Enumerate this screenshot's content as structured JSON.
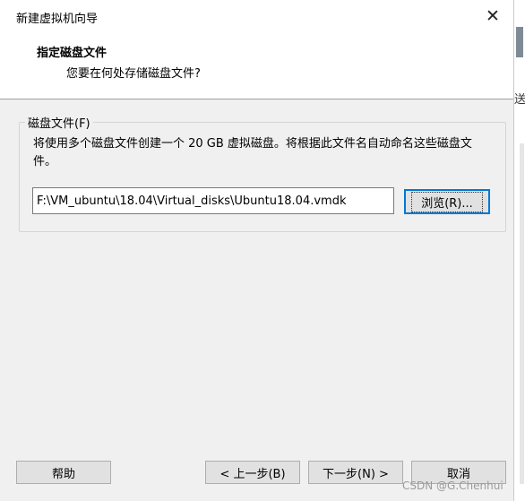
{
  "window": {
    "title": "新建虚拟机向导",
    "close_glyph": "✕"
  },
  "header": {
    "title": "指定磁盘文件",
    "subtitle": "您要在何处存储磁盘文件?"
  },
  "disk_file": {
    "group_label": "磁盘文件(F)",
    "description": "将使用多个磁盘文件创建一个 20 GB 虚拟磁盘。将根据此文件名自动命名这些磁盘文件。",
    "path_value": "F:\\VM_ubuntu\\18.04\\Virtual_disks\\Ubuntu18.04.vmdk",
    "browse_label": "浏览(R)..."
  },
  "footer": {
    "help_label": "帮助",
    "back_label": "< 上一步(B)",
    "next_label": "下一步(N) >",
    "cancel_label": "取消"
  },
  "side_panel": {
    "partial_text": "送"
  },
  "watermark": "CSDN @G.Chenhui",
  "colors": {
    "dialog_bg": "#f0f0f0",
    "header_bg": "#ffffff",
    "focus_border": "#0078d7",
    "button_bg": "#e1e1e1"
  }
}
